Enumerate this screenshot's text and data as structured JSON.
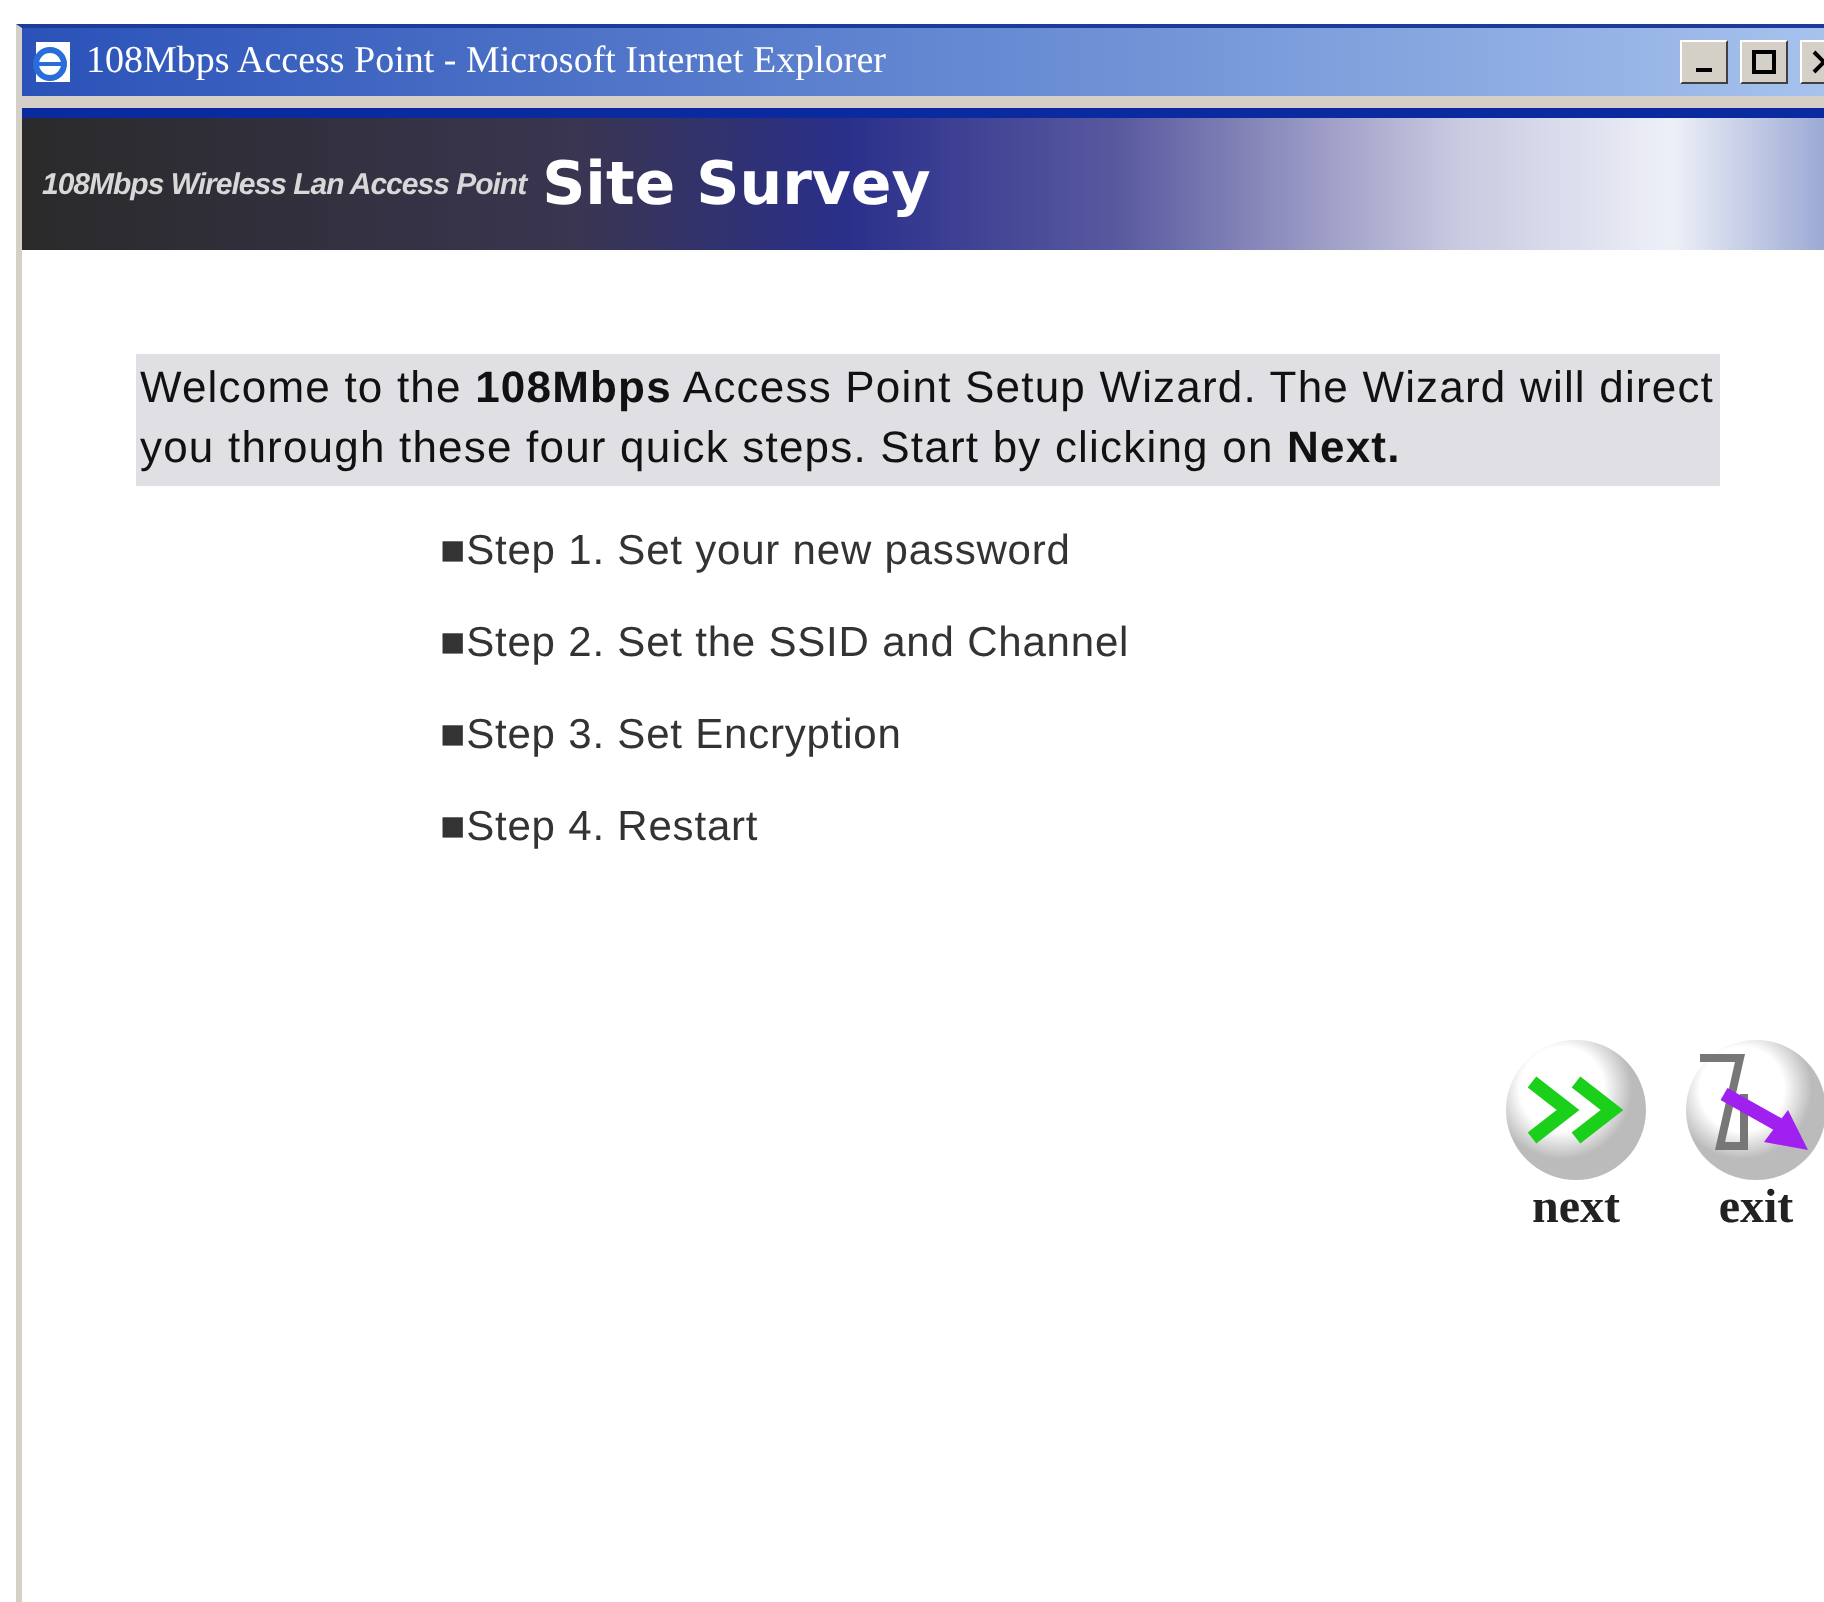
{
  "window": {
    "title": "108Mbps Access Point - Microsoft Internet Explorer"
  },
  "banner": {
    "subtitle": "108Mbps Wireless Lan Access Point",
    "title": "Site Survey"
  },
  "intro": "Welcome to the **108Mbps** Access Point Setup Wizard. The Wizard will direct you through these four quick steps. Start by clicking on **Next.**",
  "steps": [
    "■Step 1. Set your new password",
    "■Step 2. Set the SSID and Channel",
    "■Step 3. Set Encryption",
    "■Step 4. Restart"
  ],
  "buttons": [
    {
      "kind": "next",
      "label": "next"
    },
    {
      "kind": "exit",
      "label": "exit"
    }
  ]
}
